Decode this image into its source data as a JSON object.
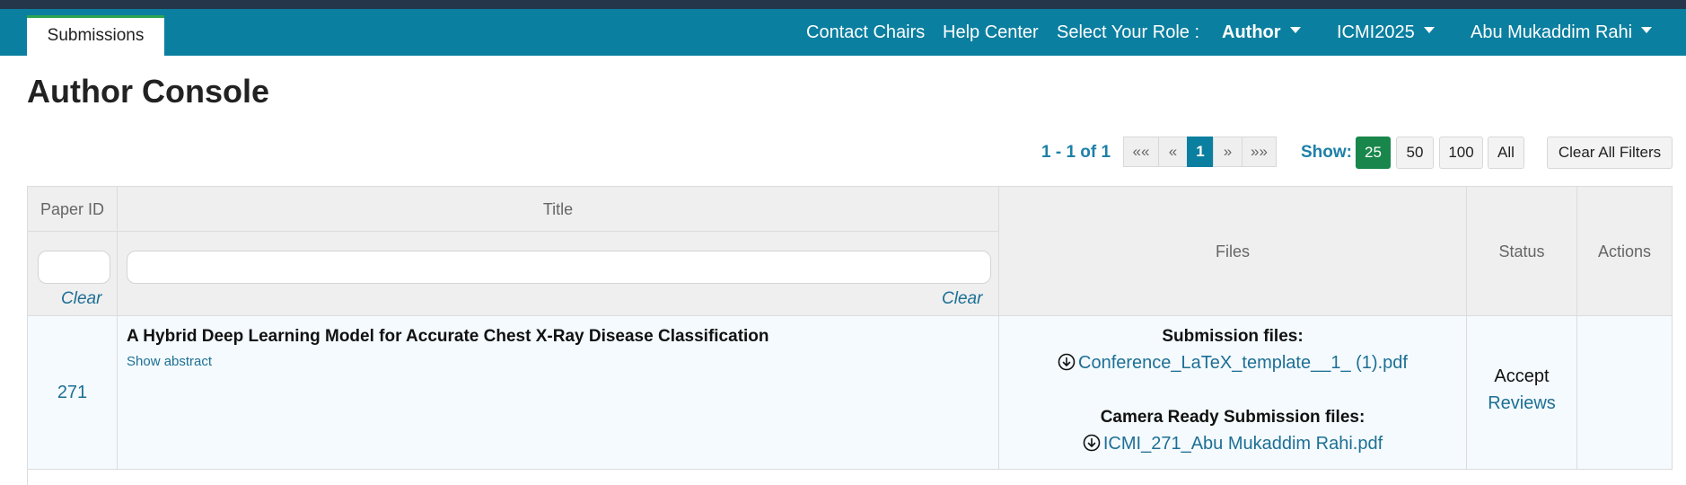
{
  "navbar": {
    "active_tab": "Submissions",
    "links": {
      "contact_chairs": "Contact Chairs",
      "help_center": "Help Center",
      "role_label": "Select Your Role :",
      "role_value": "Author",
      "conference": "ICMI2025",
      "user": "Abu Mukaddim Rahi"
    }
  },
  "page": {
    "title": "Author Console"
  },
  "pagination": {
    "range": "1 - 1 of 1",
    "first": "««",
    "prev": "«",
    "current": "1",
    "next": "»",
    "last": "»»",
    "show_label": "Show:",
    "sizes": [
      "25",
      "50",
      "100",
      "All"
    ],
    "active_size": "25",
    "clear_all": "Clear All Filters"
  },
  "table": {
    "headers": {
      "paper_id": "Paper ID",
      "title": "Title",
      "files": "Files",
      "status": "Status",
      "actions": "Actions"
    },
    "filters": {
      "paper_id_value": "",
      "title_value": "",
      "clear": "Clear"
    },
    "rows": [
      {
        "paper_id": "271",
        "title": "A Hybrid Deep Learning Model for Accurate Chest X-Ray Disease Classification",
        "show_abstract": "Show abstract",
        "submission_files_label": "Submission files:",
        "submission_file": "Conference_LaTeX_template__1_ (1).pdf",
        "camera_ready_label": "Camera Ready Submission files:",
        "camera_ready_file": "ICMI_271_Abu Mukaddim Rahi.pdf",
        "status": "Accept",
        "reviews_link": "Reviews"
      }
    ]
  },
  "colors": {
    "navbar": "#0b7fa0",
    "top_strip": "#25364a",
    "active_tab_border": "#2ca64f",
    "pager_active": "#0b7fa0",
    "show_active": "#19864b",
    "link": "#1d6f95",
    "header_bg": "#efefef",
    "row_bg": "#f4fafd"
  },
  "icons": {
    "download": "download-circle-icon",
    "dropdown": "caret-down-icon"
  }
}
